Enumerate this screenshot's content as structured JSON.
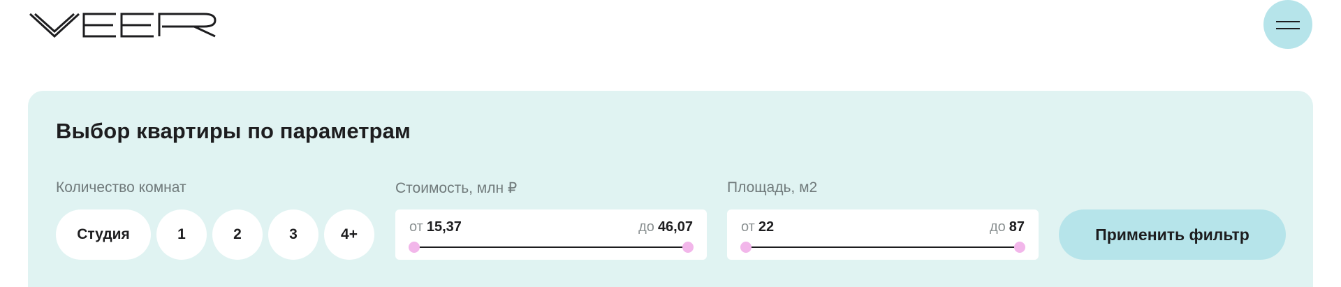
{
  "header": {
    "logo_text": "VEER",
    "menu_icon": "hamburger-icon"
  },
  "filter": {
    "title": "Выбор квартиры по параметрам",
    "rooms": {
      "label": "Количество комнат",
      "options": [
        "Студия",
        "1",
        "2",
        "3",
        "4+"
      ]
    },
    "price": {
      "label": "Стоимость, млн ₽",
      "from_prefix": "от",
      "from_value": "15,37",
      "to_prefix": "до",
      "to_value": "46,07"
    },
    "area": {
      "label": "Площадь, м2",
      "from_prefix": "от",
      "from_value": "22",
      "to_prefix": "до",
      "to_value": "87"
    },
    "apply_label": "Применить фильтр"
  },
  "colors": {
    "panel_bg": "#e0f3f2",
    "accent": "#b6e4ea",
    "slider_knob": "#f2b6ea",
    "text": "#1d1d1f",
    "muted": "#707a7b"
  }
}
